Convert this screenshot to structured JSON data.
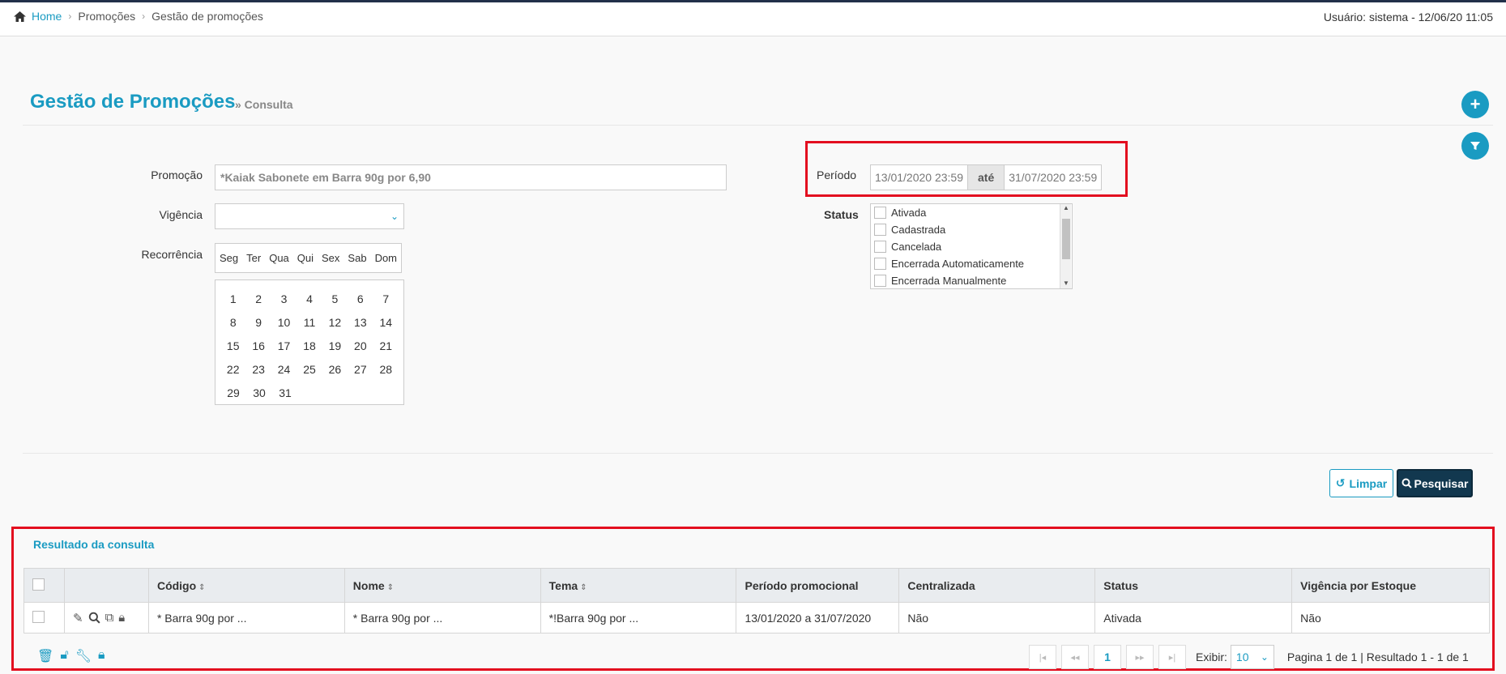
{
  "breadcrumb": {
    "home": "Home",
    "level1": "Promoções",
    "level2": "Gestão de promoções"
  },
  "user_info": "Usuário: sistema - 12/06/20 11:05",
  "page": {
    "title": "Gestão de Promoções",
    "subtitle": "» Consulta"
  },
  "form": {
    "promocao_label": "Promoção",
    "promocao_value": "*Kaiak Sabonete em Barra 90g por 6,90",
    "vigencia_label": "Vigência",
    "recorrencia_label": "Recorrência",
    "weekdays": [
      "Seg",
      "Ter",
      "Qua",
      "Qui",
      "Sex",
      "Sab",
      "Dom"
    ],
    "calendar_rows": [
      [
        "1",
        "2",
        "3",
        "4",
        "5",
        "6",
        "7"
      ],
      [
        "8",
        "9",
        "10",
        "11",
        "12",
        "13",
        "14"
      ],
      [
        "15",
        "16",
        "17",
        "18",
        "19",
        "20",
        "21"
      ],
      [
        "22",
        "23",
        "24",
        "25",
        "26",
        "27",
        "28"
      ],
      [
        "29",
        "30",
        "31"
      ]
    ],
    "periodo_label": "Período",
    "periodo_start": "13/01/2020 23:59",
    "periodo_sep": "até",
    "periodo_end": "31/07/2020 23:59",
    "status_label": "Status",
    "status_options": [
      "Ativada",
      "Cadastrada",
      "Cancelada",
      "Encerrada Automaticamente",
      "Encerrada Manualmente"
    ]
  },
  "buttons": {
    "limpar": "Limpar",
    "pesquisar": "Pesquisar"
  },
  "results": {
    "title": "Resultado da consulta",
    "columns": [
      "Código",
      "Nome",
      "Tema",
      "Período promocional",
      "Centralizada",
      "Status",
      "Vigência por Estoque"
    ],
    "rows": [
      {
        "codigo": "* Barra 90g por ...",
        "nome": "* Barra 90g por ...",
        "tema": "*!Barra 90g por ...",
        "periodo": "13/01/2020 a 31/07/2020",
        "centralizada": "Não",
        "status": "Ativada",
        "vigencia": "Não"
      }
    ],
    "pager": {
      "first": "|◂",
      "prev": "◂◂",
      "current": "1",
      "next": "▸▸",
      "last": "▸|",
      "exibir_label": "Exibir:",
      "exibir_value": "10",
      "summary": "Pagina 1 de 1 | Resultado 1 - 1 de 1"
    }
  }
}
